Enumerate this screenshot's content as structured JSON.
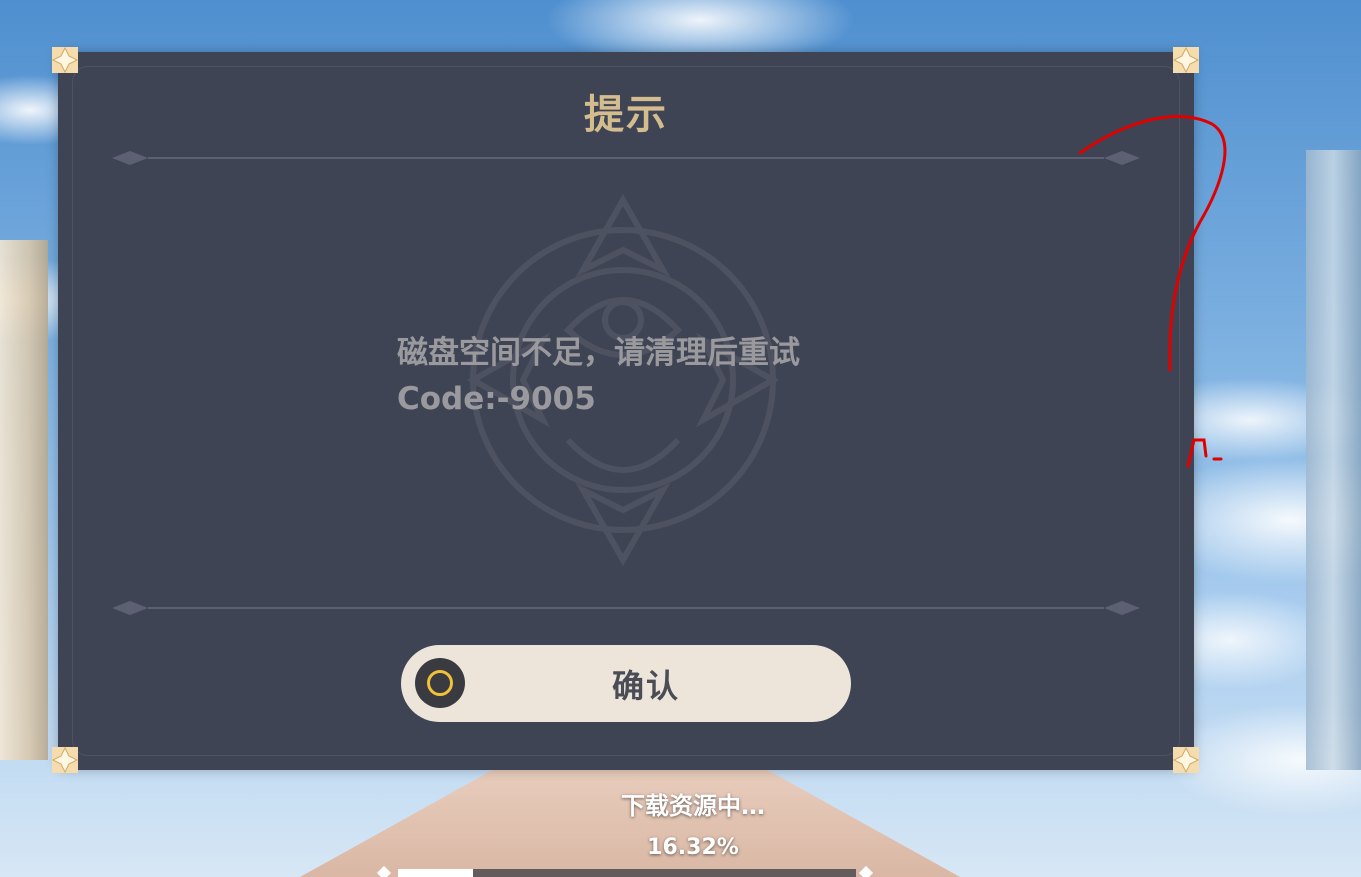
{
  "dialog": {
    "title": "提示",
    "message_line1": "磁盘空间不足，请清理后重试",
    "message_line2": "Code:-9005",
    "confirm_label": "确认",
    "confirm_icon": "circle-button-icon"
  },
  "status": {
    "text": "下载资源中…",
    "progress_text": "16.32%",
    "progress": 0.1632
  },
  "colors": {
    "dialog_bg": "#3f4454",
    "title": "#d3bc8e",
    "message": "#9a9a9e",
    "button_bg": "#ede5da",
    "button_ring": "#f0c23a",
    "annotation": "#e00000"
  }
}
